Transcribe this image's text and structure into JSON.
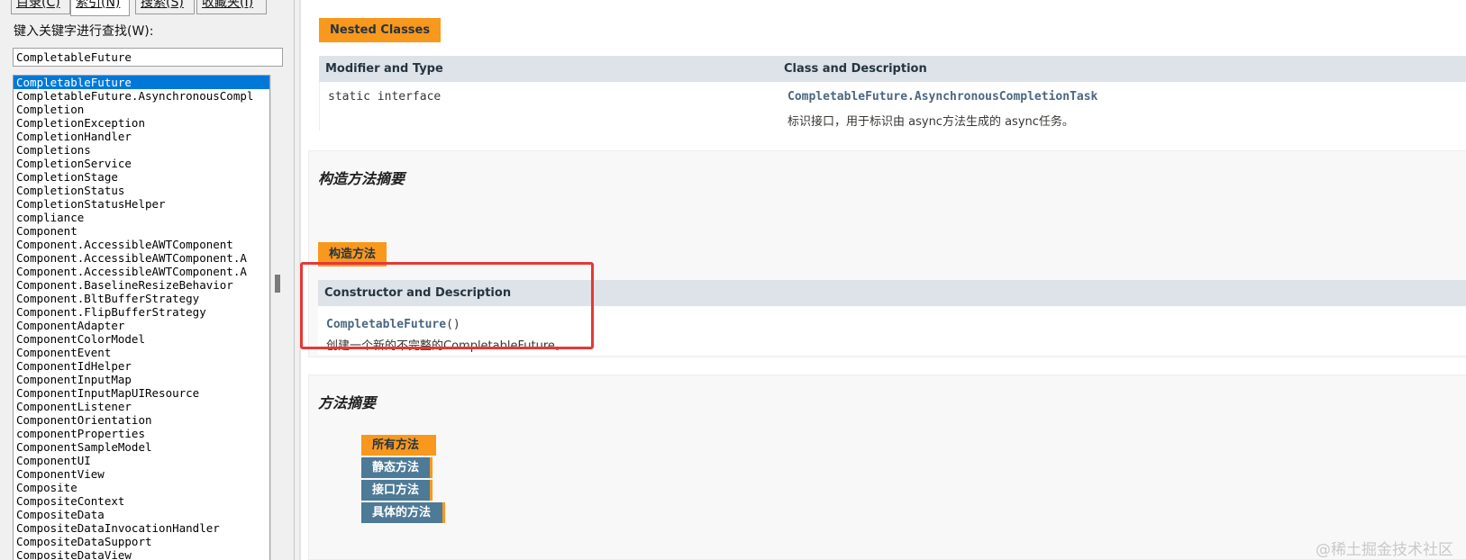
{
  "left_pane": {
    "tabs": [
      {
        "label": "目录(C)"
      },
      {
        "label": "索引(N)"
      },
      {
        "label": "搜索(S)"
      },
      {
        "label": "收藏夹(I)"
      }
    ],
    "search_label": "键入关键字进行查找(W):",
    "search_value": "CompletableFuture",
    "index_items": [
      "CompletableFuture",
      "CompletableFuture.AsynchronousCompl",
      "Completion",
      "CompletionException",
      "CompletionHandler",
      "Completions",
      "CompletionService",
      "CompletionStage",
      "CompletionStatus",
      "CompletionStatusHelper",
      "compliance",
      "Component",
      "Component.AccessibleAWTComponent",
      "Component.AccessibleAWTComponent.A",
      "Component.AccessibleAWTComponent.A",
      "Component.BaselineResizeBehavior",
      "Component.BltBufferStrategy",
      "Component.FlipBufferStrategy",
      "ComponentAdapter",
      "ComponentColorModel",
      "ComponentEvent",
      "ComponentIdHelper",
      "ComponentInputMap",
      "ComponentInputMapUIResource",
      "ComponentListener",
      "ComponentOrientation",
      "componentProperties",
      "ComponentSampleModel",
      "ComponentUI",
      "ComponentView",
      "Composite",
      "CompositeContext",
      "CompositeData",
      "CompositeDataInvocationHandler",
      "CompositeDataSupport",
      "CompositeDataView"
    ],
    "selected_index": 0
  },
  "nested": {
    "caption": "Nested Classes",
    "col_modifier": "Modifier and Type",
    "col_class": "Class and Description",
    "row": {
      "modifier": "static interface",
      "link": "CompletableFuture.AsynchronousCompletionTask",
      "description": "标识接口，用于标识由 async方法生成的 async任务。"
    }
  },
  "constructor": {
    "title": "构造方法摘要",
    "caption": "构造方法",
    "col": "Constructor and Description",
    "row": {
      "link": "CompletableFuture",
      "parens": "()",
      "description": "创建一个新的不完整的CompletableFuture。"
    }
  },
  "methods": {
    "title": "方法摘要",
    "tabs": [
      "所有方法",
      "静态方法",
      "接口方法",
      "具体的方法"
    ],
    "active_tab": 0
  },
  "watermark": "@稀土掘金技术社区",
  "colors": {
    "caption_orange": "#f8981d",
    "tab_blue": "#4d7a97",
    "header_gray": "#dee3e9",
    "link_blue": "#4a6782",
    "highlight_red": "#e53935",
    "selection_blue": "#0078d7"
  }
}
